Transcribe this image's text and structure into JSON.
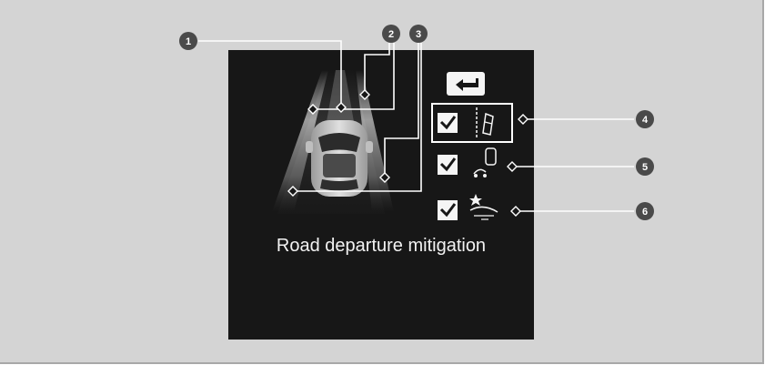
{
  "screen": {
    "title": "Road departure mitigation",
    "back_icon": "return-arrow-icon",
    "settings": [
      {
        "checked": true,
        "icon": "lane-departure-car-icon",
        "selected": true
      },
      {
        "checked": true,
        "icon": "oncoming-vehicle-icon",
        "selected": false
      },
      {
        "checked": true,
        "icon": "road-edge-collision-icon",
        "selected": false
      }
    ]
  },
  "callouts": [
    "1",
    "2",
    "3",
    "4",
    "5",
    "6"
  ],
  "colors": {
    "frame_bg": "#d4d4d4",
    "screen_bg": "#171717",
    "callout_circle": "#4a4a4a",
    "leader_line": "#ffffff",
    "lane_light": "#bdbdbd",
    "icon_white": "#f5f5f5"
  }
}
